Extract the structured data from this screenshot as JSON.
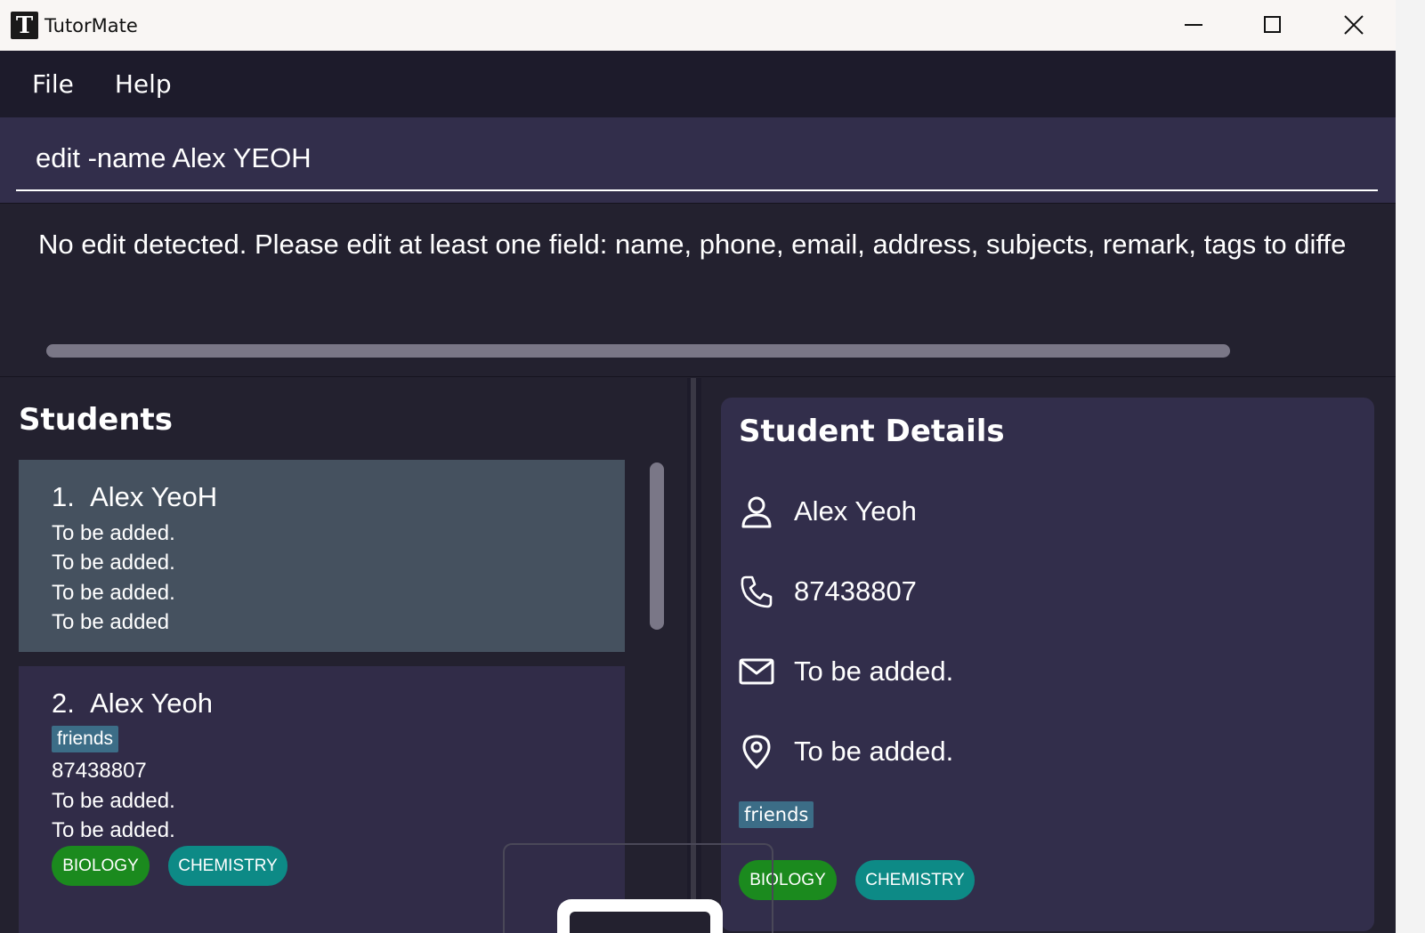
{
  "window": {
    "title": "TutorMate",
    "icon_letter": "T"
  },
  "menu": {
    "items": [
      "File",
      "Help"
    ]
  },
  "command": {
    "value": "edit -name Alex YEOH"
  },
  "result": {
    "message": "No edit detected. Please edit at least one field: name, phone, email, address, subjects, remark, tags to diffe"
  },
  "students_panel": {
    "title": "Students",
    "cards": [
      {
        "index": "1.",
        "name": "Alex YeoH",
        "lines": [
          "To be added.",
          "To be added.",
          "To be added.",
          "To be added"
        ]
      },
      {
        "index": "2.",
        "name": "Alex Yeoh",
        "tag": "friends",
        "lines": [
          "87438807",
          "To be added.",
          "To be added."
        ],
        "subjects": [
          "BIOLOGY",
          "CHEMISTRY"
        ]
      }
    ]
  },
  "details_panel": {
    "title": "Student Details",
    "name": "Alex Yeoh",
    "phone": "87438807",
    "email": "To be added.",
    "address": "To be added.",
    "tag": "friends",
    "subjects": [
      "BIOLOGY",
      "CHEMISTRY"
    ]
  },
  "colors": {
    "biology": "#1b8a1e",
    "chemistry": "#0d8a86",
    "tag": "#3c6d87",
    "selected_card": "#45515f",
    "card": "#312c48"
  },
  "icons": [
    "person-icon",
    "phone-icon",
    "mail-icon",
    "location-pin-icon",
    "minimize-icon",
    "maximize-icon",
    "close-icon"
  ]
}
